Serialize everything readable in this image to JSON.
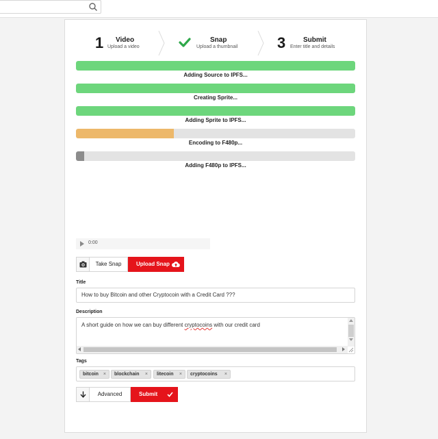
{
  "steps": [
    {
      "num": "1",
      "title": "Video",
      "sub": "Upload a video"
    },
    {
      "title": "Snap",
      "sub": "Upload a thumbnail",
      "icon": "checkmark-icon"
    },
    {
      "num": "3",
      "title": "Submit",
      "sub": "Enter title and details"
    }
  ],
  "progress": [
    {
      "label": "Adding Source to IPFS...",
      "value": 100,
      "color": "#6dd67c"
    },
    {
      "label": "Creating Sprite...",
      "value": 100,
      "color": "#6dd67c"
    },
    {
      "label": "Adding Sprite to IPFS...",
      "value": 100,
      "color": "#6dd67c"
    },
    {
      "label": "Encoding to F480p...",
      "value": 35,
      "color": "#edb86a"
    },
    {
      "label": "Adding F480p to IPFS...",
      "value": 3,
      "color": "#8c8c8c"
    }
  ],
  "player": {
    "time": "0:00"
  },
  "snap": {
    "take_label": "Take Snap",
    "upload_label": "Upload Snap"
  },
  "form": {
    "title_label": "Title",
    "title_value": "How to buy Bitcoin and other Cryptocoin with a Credit Card ???",
    "description_label": "Description",
    "description_before": "A short guide on how we can buy different ",
    "description_spell": "cryptocoins",
    "description_after": " with our credit card",
    "tags_label": "Tags",
    "tags": [
      "bitcoin",
      "blockchain",
      "litecoin",
      "cryptocoins"
    ],
    "tag_remove": "×"
  },
  "actions": {
    "advanced_label": "Advanced",
    "submit_label": "Submit"
  },
  "colors": {
    "accent_red": "#e5141b",
    "success_green": "#2ea84a"
  }
}
